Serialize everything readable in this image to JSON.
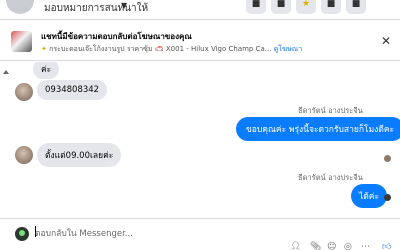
{
  "header": {
    "title": "มอบหมายการสนทนาให้",
    "icons": [
      "header-action-1",
      "header-action-2",
      "star-icon",
      "header-action-4",
      "header-action-5"
    ]
  },
  "banner": {
    "title": "แชทนี้มีข้อความตอบกลับต่อโฆษณาของคุณ",
    "sub_text": "กระบะดอนเจ๊ะโก้งงานรูป ราคาซุ้ม",
    "sub_code": "X001 - Hilux Vigo Champ Ca...",
    "link": "ดูโฆษณา",
    "close": "✕"
  },
  "messages": {
    "m1": "ค่ะ",
    "m2": "0934808342",
    "sender_out": "ธีดารัตน์ อางประจีน",
    "m3": "ขอบคุณค่ะ พรุ่งนี้จะดวกรับสายก็โมงดีคะ",
    "m4": "ตั้งแต่09.00เลยค่ะ",
    "sender_out_2": "ธีดารัตน์ อางประจีน",
    "m5": "ได้ค่ะ"
  },
  "composer": {
    "placeholder": "ตอบกลับใน Messenger..."
  },
  "colors": {
    "accent": "#0a7cff",
    "incoming": "#e4e6eb",
    "link": "#1876f2"
  }
}
